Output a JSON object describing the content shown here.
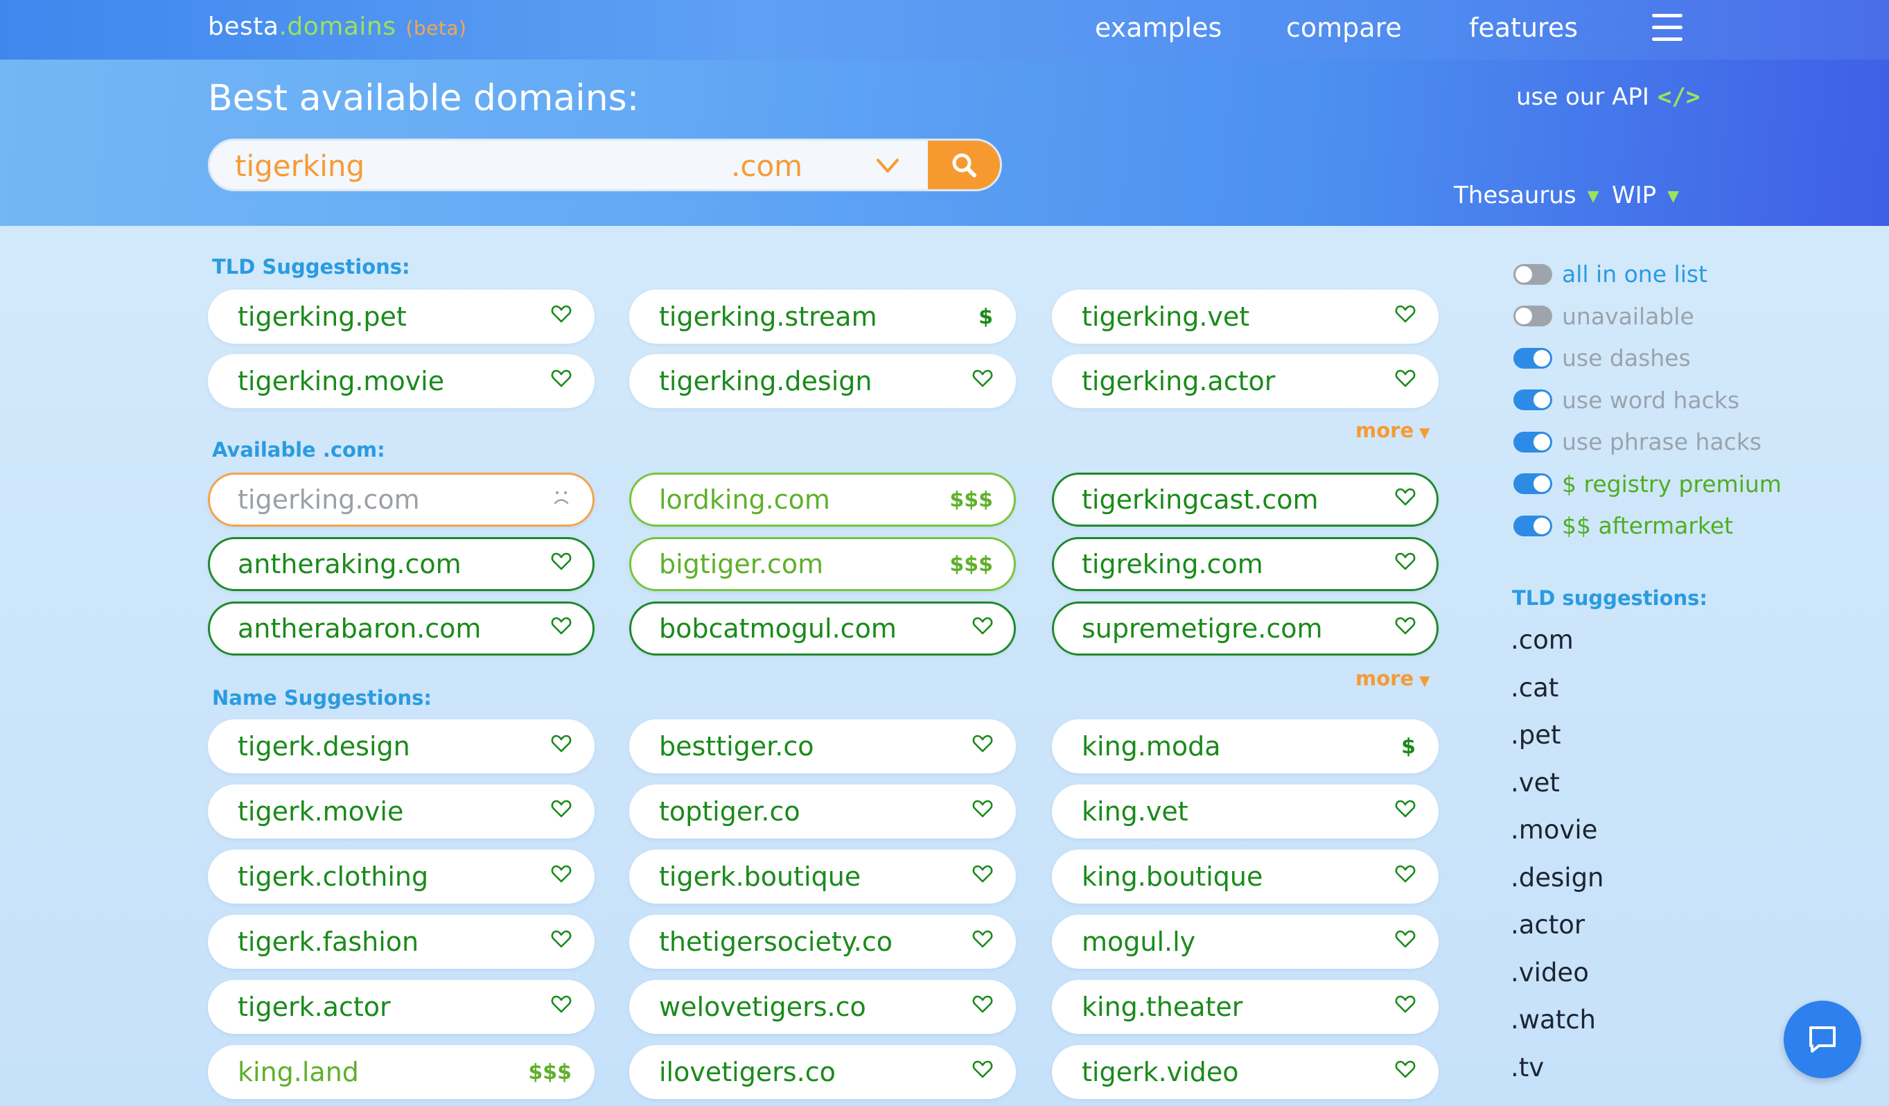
{
  "header": {
    "logo_main": "besta",
    "logo_dot": ".",
    "logo_domains": "domains",
    "logo_beta": "(beta)",
    "nav": [
      "examples",
      "compare",
      "features"
    ]
  },
  "hero": {
    "title": "Best available domains:",
    "api_label": "use our API",
    "api_code": "</>",
    "search_value": "tigerking",
    "search_placeholder": "tigerking",
    "tld": ".com",
    "dropdowns": [
      "Thesaurus",
      "WIP"
    ]
  },
  "sections": {
    "tld_label": "TLD Suggestions:",
    "available_label": "Available .com:",
    "name_label": "Name Suggestions:",
    "more_label": "more"
  },
  "tld_suggestions": [
    {
      "name": "tigerking.pet",
      "tag": "heart"
    },
    {
      "name": "tigerking.stream",
      "tag": "$"
    },
    {
      "name": "tigerking.vet",
      "tag": "heart"
    },
    {
      "name": "tigerking.movie",
      "tag": "heart"
    },
    {
      "name": "tigerking.design",
      "tag": "heart"
    },
    {
      "name": "tigerking.actor",
      "tag": "heart"
    }
  ],
  "available_com": [
    {
      "name": "tigerking.com",
      "tag": "frown",
      "state": "taken"
    },
    {
      "name": "lordking.com",
      "tag": "$$$",
      "state": "premium"
    },
    {
      "name": "tigerkingcast.com",
      "tag": "heart",
      "state": "avail"
    },
    {
      "name": "antheraking.com",
      "tag": "heart",
      "state": "avail"
    },
    {
      "name": "bigtiger.com",
      "tag": "$$$",
      "state": "premium"
    },
    {
      "name": "tigreking.com",
      "tag": "heart",
      "state": "avail"
    },
    {
      "name": "antherabaron.com",
      "tag": "heart",
      "state": "avail"
    },
    {
      "name": "bobcatmogul.com",
      "tag": "heart",
      "state": "avail"
    },
    {
      "name": "supremetigre.com",
      "tag": "heart",
      "state": "avail"
    }
  ],
  "name_suggestions": [
    {
      "name": "tigerk.design",
      "tag": "heart"
    },
    {
      "name": "besttiger.co",
      "tag": "heart"
    },
    {
      "name": "king.moda",
      "tag": "$"
    },
    {
      "name": "tigerk.movie",
      "tag": "heart"
    },
    {
      "name": "toptiger.co",
      "tag": "heart"
    },
    {
      "name": "king.vet",
      "tag": "heart"
    },
    {
      "name": "tigerk.clothing",
      "tag": "heart"
    },
    {
      "name": "tigerk.boutique",
      "tag": "heart"
    },
    {
      "name": "king.boutique",
      "tag": "heart"
    },
    {
      "name": "tigerk.fashion",
      "tag": "heart"
    },
    {
      "name": "thetigersociety.co",
      "tag": "heart"
    },
    {
      "name": "mogul.ly",
      "tag": "heart"
    },
    {
      "name": "tigerk.actor",
      "tag": "heart"
    },
    {
      "name": "welovetigers.co",
      "tag": "heart"
    },
    {
      "name": "king.theater",
      "tag": "heart"
    },
    {
      "name": "king.land",
      "tag": "$$$",
      "state": "light"
    },
    {
      "name": "ilovetigers.co",
      "tag": "heart"
    },
    {
      "name": "tigerk.video",
      "tag": "heart"
    }
  ],
  "toggles": [
    {
      "label": "all in one list",
      "on": false,
      "color": "#2a9be0"
    },
    {
      "label": "unavailable",
      "on": false,
      "color": "#9aa3ad"
    },
    {
      "label": "use dashes",
      "on": true,
      "color": "#9aa3ad"
    },
    {
      "label": "use word hacks",
      "on": true,
      "color": "#9aa3ad"
    },
    {
      "label": "use phrase hacks",
      "on": true,
      "color": "#9aa3ad"
    },
    {
      "label": "$ registry premium",
      "on": true,
      "color": "#4fae22"
    },
    {
      "label": "$$ aftermarket",
      "on": true,
      "color": "#4fae22"
    }
  ],
  "sidebar": {
    "tld_label": "TLD suggestions:",
    "tlds": [
      ".com",
      ".cat",
      ".pet",
      ".vet",
      ".movie",
      ".design",
      ".actor",
      ".video",
      ".watch",
      ".tv"
    ]
  },
  "colors": {
    "accent_orange": "#f69a2f",
    "available_green": "#1f8a2a",
    "premium_green": "#78c43a",
    "link_blue": "#2a9be0"
  }
}
